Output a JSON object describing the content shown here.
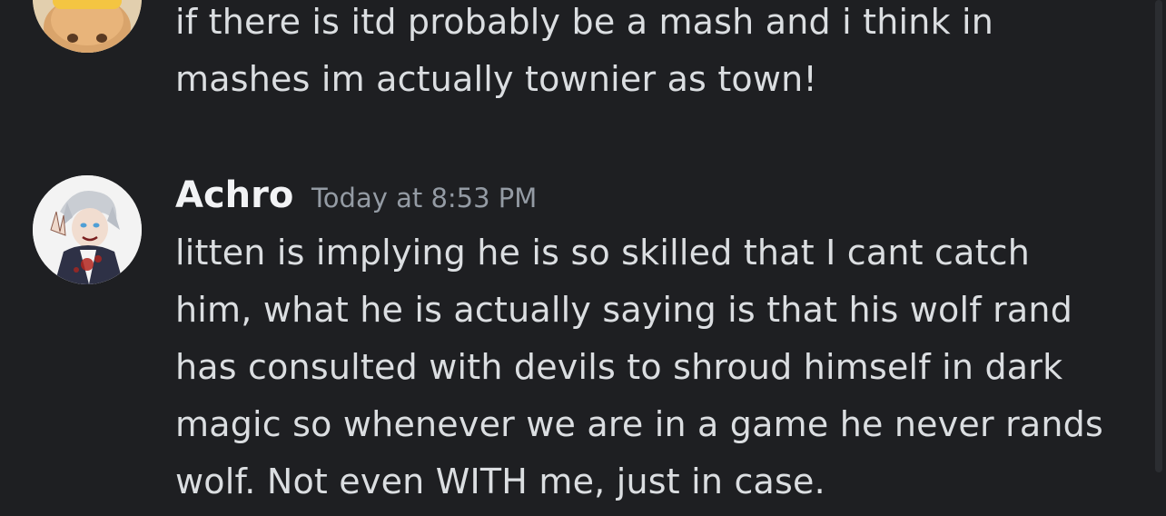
{
  "messages": [
    {
      "avatar_icon": "cat-avatar-icon",
      "lines": [
        "if there is itd probably be a mash and i think in",
        "mashes im actually townier as town!"
      ]
    },
    {
      "author": "Achro",
      "timestamp": "Today at 8:53 PM",
      "avatar_icon": "anime-character-avatar-icon",
      "lines": [
        "litten is implying he is so skilled that I cant catch",
        "him, what he is actually saying is that his wolf rand",
        "has consulted with devils to shroud himself in dark",
        "magic so whenever we are in a game he never rands",
        "wolf. Not even WITH me, just in case."
      ]
    }
  ],
  "colors": {
    "background": "#1e1f22",
    "text": "#dbdee1",
    "username": "#f2f3f5",
    "timestamp": "#949ba4"
  }
}
